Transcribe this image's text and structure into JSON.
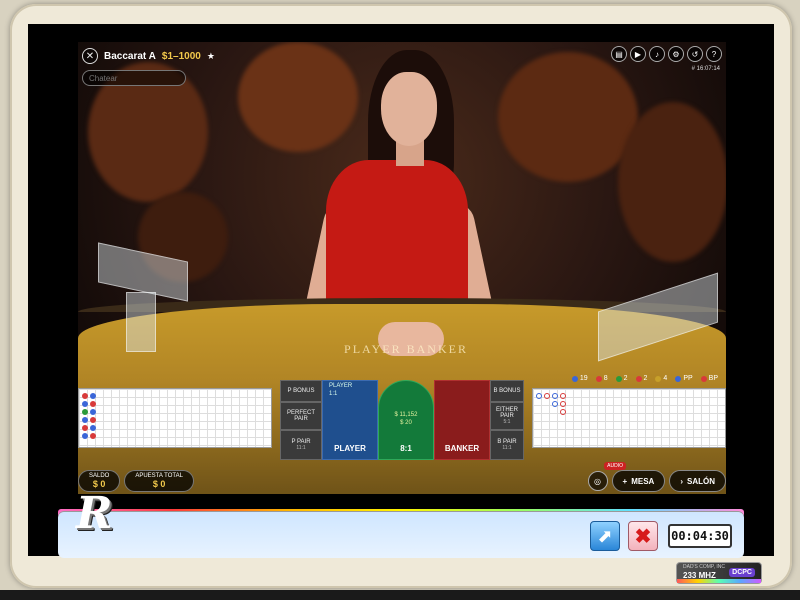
{
  "game": {
    "table_name": "Baccarat A",
    "limits": "$1–1000",
    "chat_placeholder": "Chatear",
    "game_id": "# 16:07:14",
    "felt_text": "PLAYER    BANKER"
  },
  "stats": [
    {
      "label": "19",
      "color": "#3a66d8"
    },
    {
      "label": "8",
      "color": "#d83a3a"
    },
    {
      "label": "2",
      "color": "#2a9a3a"
    },
    {
      "label": "2",
      "color": "#d83a3a"
    },
    {
      "label": "4",
      "color": "#c7a02a"
    },
    {
      "label": "PP",
      "color": "#3a66d8"
    },
    {
      "label": "BP",
      "color": "#d83a3a"
    }
  ],
  "bets": {
    "p_bonus": "P BONUS",
    "b_bonus": "B BONUS",
    "perfect_pair_left": "PERFECT PAIR",
    "perfect_pair_right": "EITHER PAIR",
    "p_pair": "P PAIR",
    "p_pair_odds": "11:1",
    "b_pair": "B PAIR",
    "b_pair_odds": "11:1",
    "pp_odds_right": "5:1",
    "player_label": "PLAYER",
    "player_badge": "PLAYER",
    "player_odds": "1:1",
    "tie_amount_top": "$ 11,152",
    "tie_amount_bottom": "$ 20",
    "tie_payout": "8:1",
    "banker_label": "BANKER"
  },
  "controls": {
    "saldo_label": "SALDO",
    "saldo_value": "$ 0",
    "apuesta_label": "APUESTA TOTAL",
    "apuesta_value": "$ 0",
    "audio_badge": "AUDIO",
    "mesa_label": "MESA",
    "salon_label": "SALÓN"
  },
  "overlay": {
    "logo_letter": "R",
    "timer": "00:04:30",
    "cpu_top": "DAD'S COMP, INC",
    "cpu_speed": "233 MHZ",
    "cpu_logo": "DCPC"
  },
  "icons": {
    "close": "✕",
    "star": "★",
    "arrow": "⬈",
    "x": "✖"
  }
}
